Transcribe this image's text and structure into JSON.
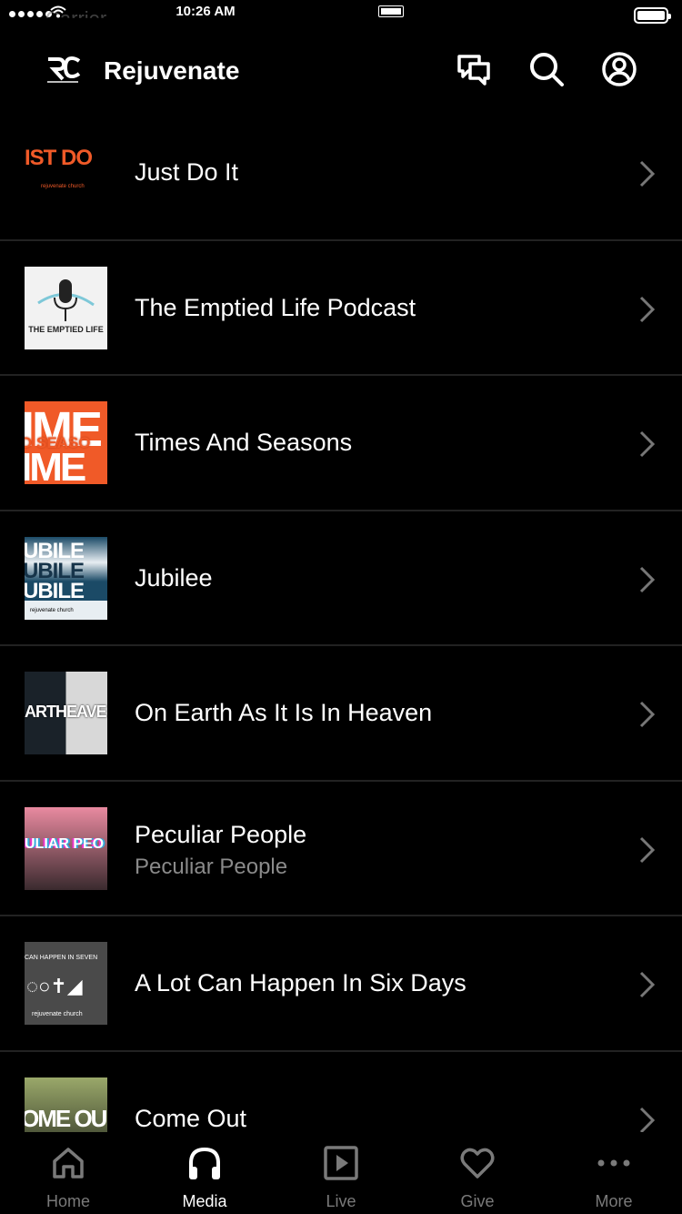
{
  "status_bar": {
    "time": "10:26 AM",
    "carrier": "Carrier"
  },
  "header": {
    "title": "Rejuvenate"
  },
  "list": [
    {
      "title": "Just Do It",
      "subtitle": "",
      "thumb_text": "IST DO",
      "thumb_caption": "rejuvenate church"
    },
    {
      "title": "The Emptied Life Podcast",
      "subtitle": "",
      "thumb_text": "THE EMPTIED LIFE"
    },
    {
      "title": "Times And Seasons",
      "subtitle": "",
      "thumb_text": "D SEASO"
    },
    {
      "title": "Jubilee",
      "subtitle": "",
      "thumb_text": "UBILE",
      "thumb_caption": "rejuvenate church"
    },
    {
      "title": "On Earth As It Is In Heaven",
      "subtitle": "",
      "thumb_text": "ARTHEAVE"
    },
    {
      "title": "Peculiar People",
      "subtitle": "Peculiar People",
      "thumb_text": "ULIAR PEO"
    },
    {
      "title": "A Lot Can Happen In Six Days",
      "subtitle": "",
      "thumb_text": "CAN HAPPEN IN SEVEN",
      "thumb_caption": "rejuvenate church"
    },
    {
      "title": "Come Out",
      "subtitle": "",
      "thumb_text": "OME OU"
    }
  ],
  "tabs": [
    {
      "label": "Home",
      "icon": "home-icon",
      "active": false
    },
    {
      "label": "Media",
      "icon": "headphones-icon",
      "active": true
    },
    {
      "label": "Live",
      "icon": "play-icon",
      "active": false
    },
    {
      "label": "Give",
      "icon": "heart-icon",
      "active": false
    },
    {
      "label": "More",
      "icon": "more-icon",
      "active": false
    }
  ],
  "colors": {
    "background": "#000000",
    "divider": "#222222",
    "inactive": "#7a7a7a",
    "accent_orange": "#f05a28"
  }
}
